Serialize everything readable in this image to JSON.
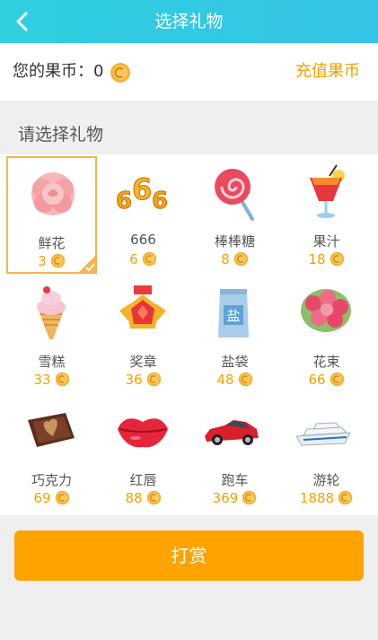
{
  "header": {
    "title": "选择礼物",
    "back_icon": "back-arrow-icon"
  },
  "balance": {
    "label": "您的果币：0",
    "recharge_label": "充值果币",
    "coin_icon": "coin-icon"
  },
  "section": {
    "title": "请选择礼物"
  },
  "gifts": [
    {
      "name": "鲜花",
      "price": "3",
      "icon": "rose-icon",
      "selected": true
    },
    {
      "name": "666",
      "price": "6",
      "icon": "666-icon"
    },
    {
      "name": "棒棒糖",
      "price": "8",
      "icon": "lollipop-icon"
    },
    {
      "name": "果汁",
      "price": "18",
      "icon": "juice-icon"
    },
    {
      "name": "雪糕",
      "price": "33",
      "icon": "ice-cream-icon"
    },
    {
      "name": "奖章",
      "price": "36",
      "icon": "medal-icon"
    },
    {
      "name": "盐袋",
      "price": "48",
      "icon": "salt-bag-icon",
      "bag_text": "盐"
    },
    {
      "name": "花束",
      "price": "66",
      "icon": "bouquet-icon"
    },
    {
      "name": "巧克力",
      "price": "69",
      "icon": "chocolate-icon"
    },
    {
      "name": "红唇",
      "price": "88",
      "icon": "lips-icon"
    },
    {
      "name": "跑车",
      "price": "369",
      "icon": "sports-car-icon"
    },
    {
      "name": "游轮",
      "price": "1888",
      "icon": "cruise-ship-icon"
    }
  ],
  "action": {
    "reward_label": "打赏"
  },
  "colors": {
    "accent": "#ffa300",
    "header": "#33c8e3",
    "price": "#f5a000",
    "selected_border": "#f7b54a"
  }
}
